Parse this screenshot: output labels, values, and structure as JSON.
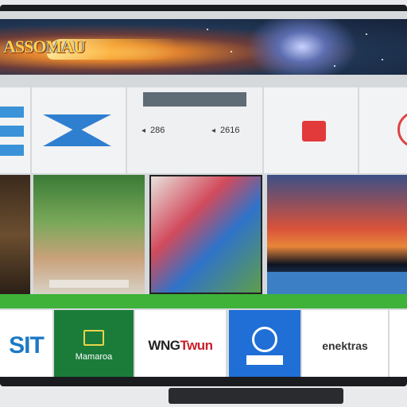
{
  "banner": {
    "logo_text": "ASSOMAU"
  },
  "tiles_top": {
    "stat_left": "286",
    "stat_right": "2616"
  },
  "apps": [
    {
      "label": "SIT"
    },
    {
      "label": "Mamaroa"
    },
    {
      "label_red": "Twun",
      "label_dark": "WNG"
    },
    {
      "label": ""
    },
    {
      "label": "enektras"
    }
  ],
  "colors": {
    "accent_green": "#3fb23a",
    "accent_blue": "#1f6fd6",
    "brand_red": "#e23a3a"
  }
}
